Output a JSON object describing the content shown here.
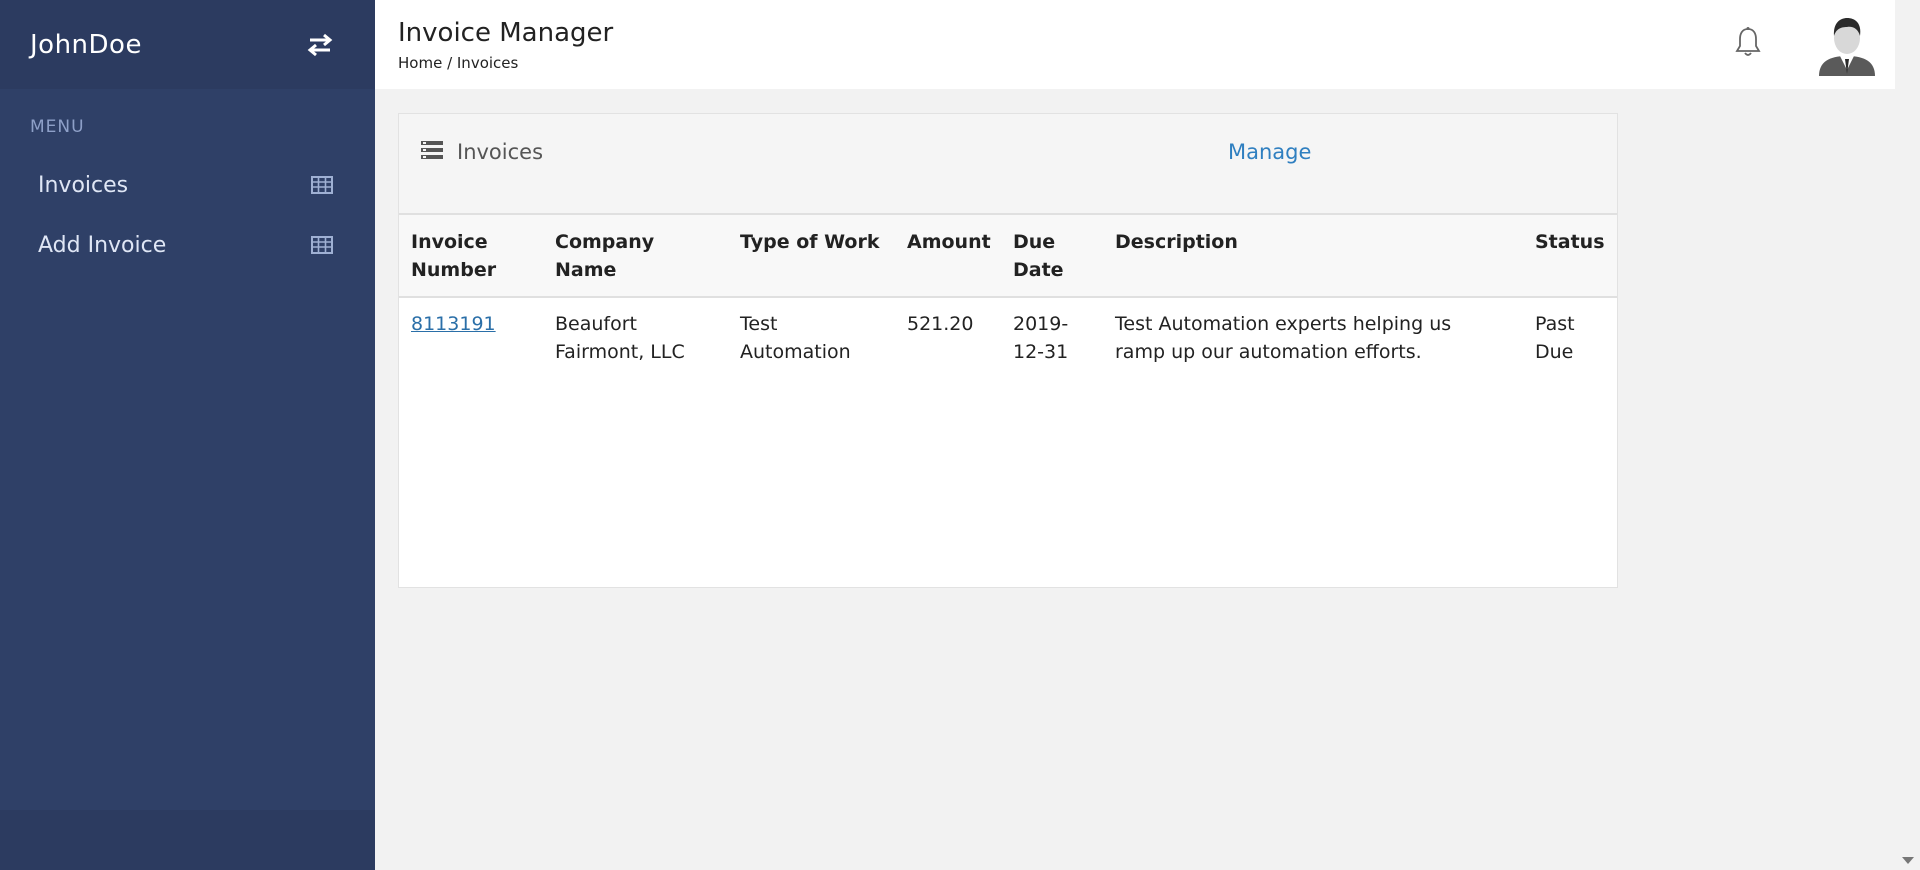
{
  "sidebar": {
    "brand": "JohnDoe",
    "menu_caption": "MENU",
    "items": [
      {
        "label": "Invoices",
        "icon": "table-icon"
      },
      {
        "label": "Add Invoice",
        "icon": "table-icon"
      }
    ]
  },
  "header": {
    "title": "Invoice Manager",
    "breadcrumb": "Home / Invoices"
  },
  "panel": {
    "title": "Invoices",
    "manage_label": "Manage"
  },
  "table": {
    "columns": [
      {
        "line1": "Invoice",
        "line2": "Number"
      },
      {
        "line1": "Company",
        "line2": "Name"
      },
      {
        "line1": "Type of Work",
        "line2": ""
      },
      {
        "line1": "Amount",
        "line2": ""
      },
      {
        "line1": "Due",
        "line2": "Date"
      },
      {
        "line1": "Description",
        "line2": ""
      },
      {
        "line1": "Status",
        "line2": ""
      }
    ],
    "rows": [
      {
        "invoice_number": "8113191",
        "company_line1": "Beaufort",
        "company_line2": "Fairmont, LLC",
        "type_line1": "Test",
        "type_line2": "Automation",
        "amount": "521.20",
        "due_line1": "2019-",
        "due_line2": "12-31",
        "desc_line1": "Test Automation experts helping us",
        "desc_line2": "ramp up our automation efforts.",
        "status_line1": "Past",
        "status_line2": "Due"
      }
    ]
  },
  "colors": {
    "sidebar": "#2f4067",
    "sidebar_header": "#2c3b60",
    "link": "#2f7fc0",
    "background": "#f2f2f2"
  }
}
